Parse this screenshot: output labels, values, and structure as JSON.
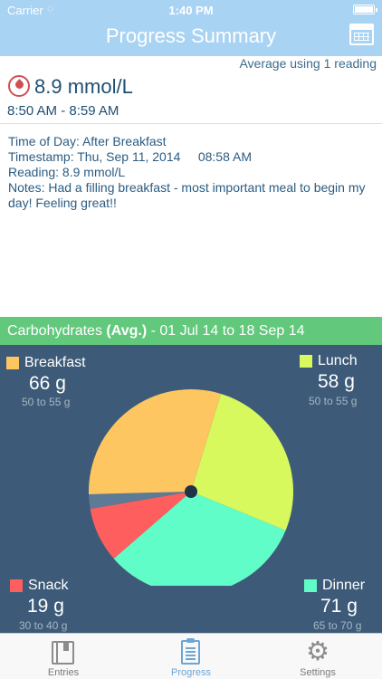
{
  "status_bar": {
    "carrier": "Carrier",
    "time": "1:40 PM"
  },
  "nav": {
    "title": "Progress Summary",
    "calendar_icon": "calendar-icon"
  },
  "summary": {
    "average_note": "Average using 1 reading",
    "reading_value": "8.9 mmol/L",
    "time_range": "8:50 AM - 8:59 AM",
    "drop_icon": "blood-drop-icon"
  },
  "details": {
    "time_of_day": "Time of Day: After Breakfast",
    "timestamp": "Timestamp: Thu, Sep 11, 2014     08:58 AM",
    "reading": "Reading: 8.9 mmol/L",
    "notes": "Notes: Had a filling breakfast - most important meal to begin my day! Feeling great!!"
  },
  "carbs": {
    "title": "Carbohydrates",
    "avg_label": "(Avg.)",
    "date_range": "- 01 Jul 14 to 18 Sep 14"
  },
  "categories": {
    "breakfast": {
      "name": "Breakfast",
      "value": "66 g",
      "range": "50 to 55 g",
      "color": "#fec660"
    },
    "lunch": {
      "name": "Lunch",
      "value": "58 g",
      "range": "50 to 55 g",
      "color": "#d7f95e"
    },
    "snack": {
      "name": "Snack",
      "value": "19 g",
      "range": "30 to 40 g",
      "color": "#fe5f5e"
    },
    "dinner": {
      "name": "Dinner",
      "value": "71 g",
      "range": "65 to 70 g",
      "color": "#61fdc9"
    }
  },
  "chart_data": {
    "type": "pie",
    "categories": [
      "Lunch",
      "Dinner",
      "Snack",
      "Other",
      "Breakfast"
    ],
    "values": [
      58,
      71,
      19,
      5,
      66
    ],
    "colors": [
      "#d7f95e",
      "#61fdc9",
      "#fe5f5e",
      "#5d7a96",
      "#fec660"
    ],
    "start_angle_deg": 17
  },
  "tabs": [
    {
      "label": "Entries",
      "icon": "book-icon",
      "active": false
    },
    {
      "label": "Progress",
      "icon": "clipboard-icon",
      "active": true
    },
    {
      "label": "Settings",
      "icon": "gear-icon",
      "active": false
    }
  ]
}
